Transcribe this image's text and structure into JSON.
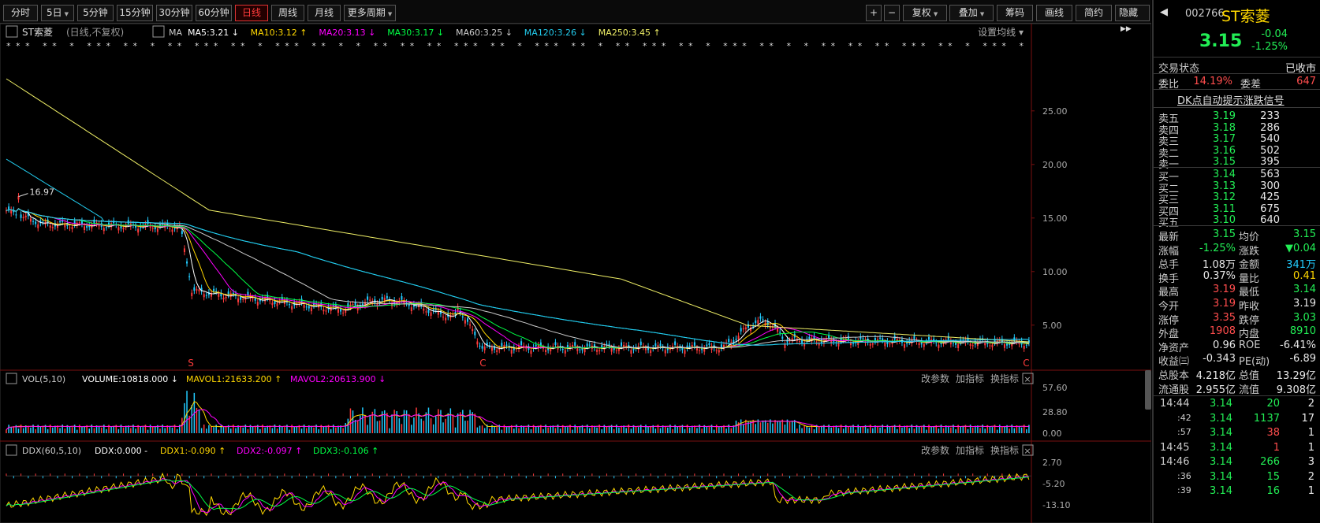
{
  "toolbar": {
    "periods": [
      "分时",
      "5日",
      "5分钟",
      "15分钟",
      "30分钟",
      "60分钟",
      "日线",
      "周线",
      "月线",
      "更多周期"
    ],
    "active": "日线",
    "right": [
      "+",
      "−",
      "复权",
      "叠加",
      "筹码",
      "画线",
      "简约",
      "隐藏"
    ]
  },
  "ma_header": {
    "name": "ST索菱",
    "note": "(日线,不复权)",
    "ma": "MA",
    "items": [
      {
        "text": "MA5:3.21",
        "arrow": "↓",
        "color": "#ffffff"
      },
      {
        "text": "MA10:3.12",
        "arrow": "↑",
        "color": "#ffd700"
      },
      {
        "text": "MA20:3.13",
        "arrow": "↓",
        "color": "#ff00ff"
      },
      {
        "text": "MA30:3.17",
        "arrow": "↓",
        "color": "#00ff44"
      },
      {
        "text": "MA60:3.25",
        "arrow": "↓",
        "color": "#cccccc"
      },
      {
        "text": "MA120:3.26",
        "arrow": "↓",
        "color": "#22ccee"
      },
      {
        "text": "MA250:3.45",
        "arrow": "↑",
        "color": "#eeee66"
      }
    ],
    "setting": "设置均线"
  },
  "price_axis": [
    "25.00",
    "20.00",
    "15.00",
    "10.00",
    "5.00"
  ],
  "high_mark": "16.97",
  "signals": [
    "S",
    "C",
    "C"
  ],
  "vol_header": {
    "title": "VOL(5,10)",
    "items": [
      {
        "text": "VOLUME:10818.000",
        "arrow": "↓",
        "color": "#ffffff"
      },
      {
        "text": "MAVOL1:21633.200",
        "arrow": "↑",
        "color": "#ffd700"
      },
      {
        "text": "MAVOL2:20613.900",
        "arrow": "↓",
        "color": "#ff00ff"
      }
    ]
  },
  "vol_axis": [
    "57.60",
    "28.80",
    "0.00"
  ],
  "ddx_header": {
    "title": "DDX(60,5,10)",
    "items": [
      {
        "text": "DDX:0.000",
        "arrow": "-",
        "color": "#ffffff"
      },
      {
        "text": "DDX1:-0.090",
        "arrow": "↑",
        "color": "#ffd700"
      },
      {
        "text": "DDX2:-0.097",
        "arrow": "↑",
        "color": "#ff00ff"
      },
      {
        "text": "DDX3:-0.106",
        "arrow": "↑",
        "color": "#00ff44"
      }
    ]
  },
  "ddx_axis": [
    "2.70",
    "-5.20",
    "-13.10"
  ],
  "ind_buttons": [
    "改参数",
    "加指标",
    "换指标"
  ],
  "stock": {
    "code": "002766",
    "name": "ST索菱",
    "price": "3.15",
    "chg": "-0.04",
    "pct": "-1.25%"
  },
  "trade": {
    "status_label": "交易状态",
    "status": "已收市",
    "wb_label": "委比",
    "wb": "14.19%",
    "wc_label": "委差",
    "wc": "647",
    "link": "DK点自动提示涨跌信号"
  },
  "asks": [
    {
      "l": "卖五",
      "p": "3.19",
      "v": "233"
    },
    {
      "l": "卖四",
      "p": "3.18",
      "v": "286"
    },
    {
      "l": "卖三",
      "p": "3.17",
      "v": "540"
    },
    {
      "l": "卖二",
      "p": "3.16",
      "v": "502"
    },
    {
      "l": "卖一",
      "p": "3.15",
      "v": "395"
    }
  ],
  "bids": [
    {
      "l": "买一",
      "p": "3.14",
      "v": "563"
    },
    {
      "l": "买二",
      "p": "3.13",
      "v": "300"
    },
    {
      "l": "买三",
      "p": "3.12",
      "v": "425"
    },
    {
      "l": "买四",
      "p": "3.11",
      "v": "675"
    },
    {
      "l": "买五",
      "p": "3.10",
      "v": "640"
    }
  ],
  "stats": [
    {
      "l1": "最新",
      "v1": "3.15",
      "c1": "g",
      "l2": "均价",
      "v2": "3.15",
      "c2": "g"
    },
    {
      "l1": "涨幅",
      "v1": "-1.25%",
      "c1": "g",
      "l2": "涨跌",
      "v2": "▼0.04",
      "c2": "g"
    },
    {
      "l1": "总手",
      "v1": "1.08万",
      "c1": "w",
      "l2": "金额",
      "v2": "341万",
      "c2": "c"
    },
    {
      "l1": "换手",
      "v1": "0.37%",
      "c1": "w",
      "l2": "量比",
      "v2": "0.41",
      "c2": "y"
    },
    {
      "l1": "最高",
      "v1": "3.19",
      "c1": "r",
      "l2": "最低",
      "v2": "3.14",
      "c2": "g"
    },
    {
      "l1": "今开",
      "v1": "3.19",
      "c1": "r",
      "l2": "昨收",
      "v2": "3.19",
      "c2": "w"
    },
    {
      "l1": "涨停",
      "v1": "3.35",
      "c1": "r",
      "l2": "跌停",
      "v2": "3.03",
      "c2": "g"
    },
    {
      "l1": "外盘",
      "v1": "1908",
      "c1": "r",
      "l2": "内盘",
      "v2": "8910",
      "c2": "g"
    },
    {
      "l1": "净资产",
      "v1": "0.96",
      "c1": "w",
      "l2": "ROE",
      "v2": "-6.41%",
      "c2": "w"
    },
    {
      "l1": "收益㈢",
      "v1": "-0.343",
      "c1": "w",
      "l2": "PE(动)",
      "v2": "-6.89",
      "c2": "w"
    },
    {
      "l1": "总股本",
      "v1": "4.218亿",
      "c1": "w",
      "l2": "总值",
      "v2": "13.29亿",
      "c2": "w"
    },
    {
      "l1": "流通股",
      "v1": "2.955亿",
      "c1": "w",
      "l2": "流值",
      "v2": "9.308亿",
      "c2": "w"
    }
  ],
  "ticks": [
    {
      "t": "14:44",
      "p": "3.14",
      "v": "20",
      "vc": "g",
      "n": "2"
    },
    {
      "t": ":42",
      "p": "3.14",
      "v": "1137",
      "vc": "g",
      "n": "17"
    },
    {
      "t": ":57",
      "p": "3.14",
      "v": "38",
      "vc": "r",
      "n": "1"
    },
    {
      "t": "14:45",
      "p": "3.14",
      "v": "1",
      "vc": "r",
      "n": "1"
    },
    {
      "t": "14:46",
      "p": "3.14",
      "v": "266",
      "vc": "g",
      "n": "3"
    },
    {
      "t": ":36",
      "p": "3.14",
      "v": "15",
      "vc": "g",
      "n": "2"
    },
    {
      "t": ":39",
      "p": "3.14",
      "v": "16",
      "vc": "g",
      "n": "1"
    }
  ]
}
